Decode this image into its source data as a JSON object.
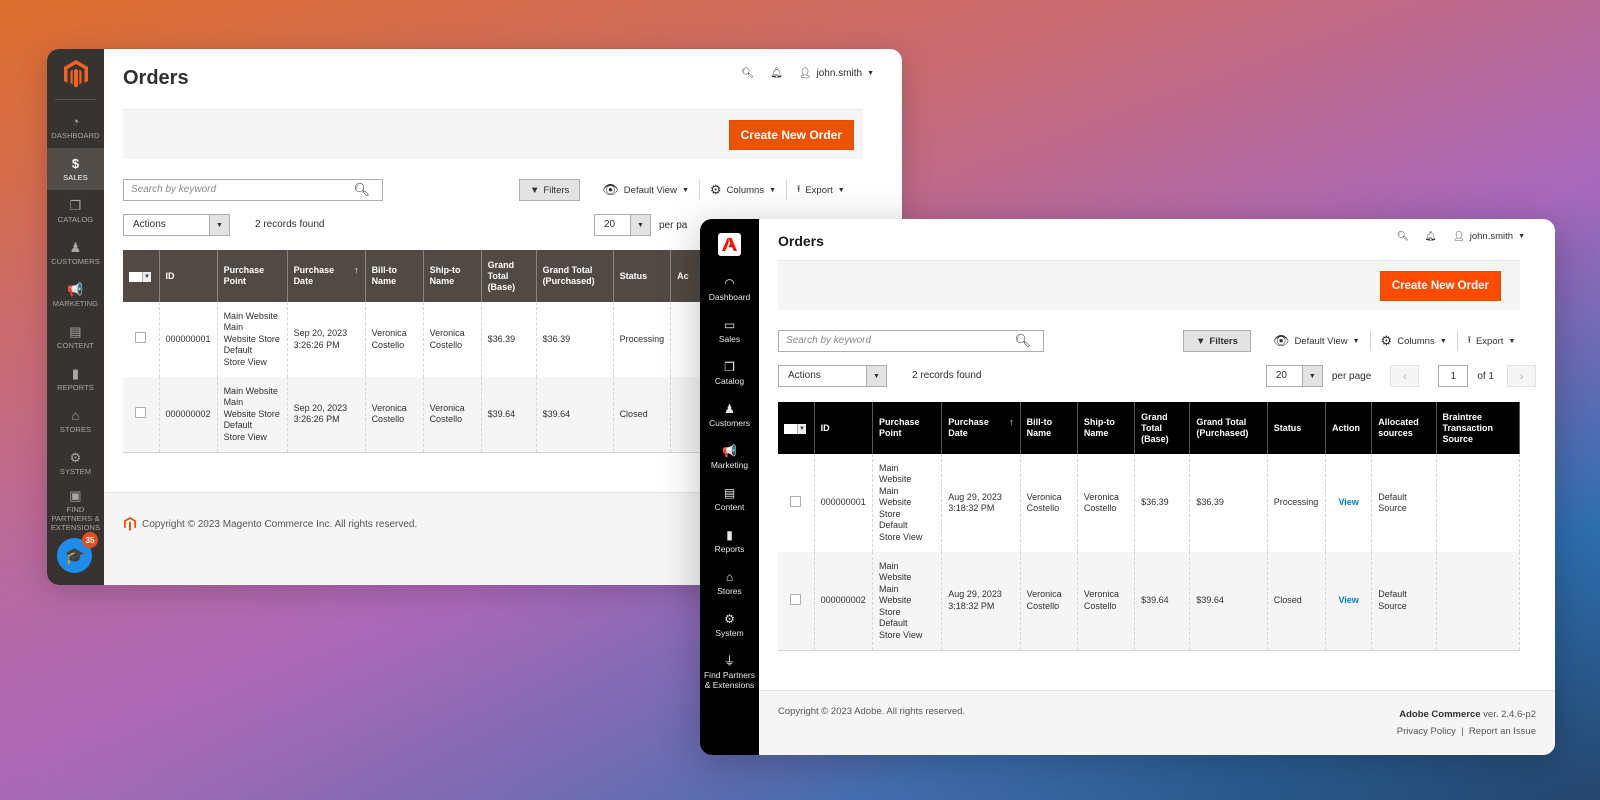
{
  "colors": {
    "magento_orange": "#eb5202",
    "adobe_orange": "#ff4b00",
    "old_sidebar": "#373330",
    "old_table_header": "#514943",
    "new_sidebar": "#000000",
    "link_blue": "#007bdb",
    "help_blue": "#1f8ceb"
  },
  "old_window": {
    "sidebar": {
      "items": [
        {
          "icon": "dashboard-icon",
          "glyph": "◔",
          "label": "DASHBOARD"
        },
        {
          "icon": "dollar-icon",
          "glyph": "$",
          "label": "SALES",
          "active": true
        },
        {
          "icon": "box-icon",
          "glyph": "❒",
          "label": "CATALOG"
        },
        {
          "icon": "person-icon",
          "glyph": "♟",
          "label": "CUSTOMERS"
        },
        {
          "icon": "megaphone-icon",
          "glyph": "📢",
          "label": "MARKETING"
        },
        {
          "icon": "content-icon",
          "glyph": "▤",
          "label": "CONTENT"
        },
        {
          "icon": "bar-chart-icon",
          "glyph": "▮",
          "label": "REPORTS"
        },
        {
          "icon": "store-icon",
          "glyph": "⌂",
          "label": "STORES"
        },
        {
          "icon": "gear-icon",
          "glyph": "⚙",
          "label": "SYSTEM"
        },
        {
          "icon": "lego-icon",
          "glyph": "▣",
          "label": "FIND PARTNERS & EXTENSIONS"
        }
      ],
      "help_badge_count": "35"
    },
    "header": {
      "title": "Orders",
      "username": "john.smith"
    },
    "create_button": "Create New Order",
    "search_placeholder": "Search by keyword",
    "toolbar": {
      "filters": "Filters",
      "view": "Default View",
      "columns": "Columns",
      "export": "Export"
    },
    "actions_label": "Actions",
    "records_found": "2 records found",
    "per_page_value": "20",
    "per_page_label": "per pa",
    "table": {
      "headers": [
        "ID",
        "Purchase Point",
        "Purchase Date",
        "Bill-to Name",
        "Ship-to Name",
        "Grand Total (Base)",
        "Grand Total (Purchased)",
        "Status",
        "Ac"
      ],
      "rows": [
        {
          "id": "000000001",
          "purchase_point": "Main Website\n Main\n Website Store\n  Default\n Store View",
          "date": "Sep 20, 2023 3:26:26 PM",
          "bill_to": "Veronica Costello",
          "ship_to": "Veronica Costello",
          "grand_base": "$36.39",
          "grand_purchased": "$36.39",
          "status": "Processing"
        },
        {
          "id": "000000002",
          "purchase_point": "Main Website\n Main\n Website Store\n  Default\n Store View",
          "date": "Sep 20, 2023 3:26:26 PM",
          "bill_to": "Veronica Costello",
          "ship_to": "Veronica Costello",
          "grand_base": "$39.64",
          "grand_purchased": "$39.64",
          "status": "Closed"
        }
      ]
    },
    "footer": {
      "copyright": "Copyright © 2023 Magento Commerce Inc. All rights reserved."
    }
  },
  "new_window": {
    "sidebar": {
      "items": [
        {
          "icon": "gauge-icon",
          "glyph": "◠",
          "label": "Dashboard"
        },
        {
          "icon": "money-icon",
          "glyph": "▭",
          "label": "Sales"
        },
        {
          "icon": "box-icon",
          "glyph": "❒",
          "label": "Catalog"
        },
        {
          "icon": "people-icon",
          "glyph": "♟",
          "label": "Customers"
        },
        {
          "icon": "megaphone-icon",
          "glyph": "📢",
          "label": "Marketing"
        },
        {
          "icon": "content-icon",
          "glyph": "▤",
          "label": "Content"
        },
        {
          "icon": "bar-chart-icon",
          "glyph": "▮",
          "label": "Reports"
        },
        {
          "icon": "store-icon",
          "glyph": "⌂",
          "label": "Stores"
        },
        {
          "icon": "gear-icon",
          "glyph": "⚙",
          "label": "System"
        },
        {
          "icon": "plug-icon",
          "glyph": "⏚",
          "label": "Find Partners & Extensions"
        }
      ]
    },
    "header": {
      "title": "Orders",
      "username": "john.smith"
    },
    "create_button": "Create New Order",
    "search_placeholder": "Search by keyword",
    "toolbar": {
      "filters": "Filters",
      "view": "Default View",
      "columns": "Columns",
      "export": "Export"
    },
    "actions_label": "Actions",
    "records_found": "2 records found",
    "pager": {
      "per_page_value": "20",
      "per_page_label": "per page",
      "current_page": "1",
      "of_label": "of 1"
    },
    "table": {
      "headers": [
        "ID",
        "Purchase Point",
        "Purchase Date",
        "Bill-to Name",
        "Ship-to Name",
        "Grand Total (Base)",
        "Grand Total (Purchased)",
        "Status",
        "Action",
        "Allocated sources",
        "Braintree Transaction Source"
      ],
      "rows": [
        {
          "id": "000000001",
          "purchase_point": "Main\nWebsite\n Main\nWebsite\nStore\n  Default\nStore View",
          "date": "Aug 29, 2023 3:18:32 PM",
          "bill_to": "Veronica Costello",
          "ship_to": "Veronica Costello",
          "grand_base": "$36.39",
          "grand_purchased": "$36.39",
          "status": "Processing",
          "action": "View",
          "allocated": "Default Source",
          "braintree": ""
        },
        {
          "id": "000000002",
          "purchase_point": "Main\nWebsite\n Main\nWebsite\nStore\n  Default\nStore View",
          "date": "Aug 29, 2023 3:18:32 PM",
          "bill_to": "Veronica Costello",
          "ship_to": "Veronica Costello",
          "grand_base": "$39.64",
          "grand_purchased": "$39.64",
          "status": "Closed",
          "action": "View",
          "allocated": "Default Source",
          "braintree": ""
        }
      ]
    },
    "footer": {
      "copyright": "Copyright © 2023 Adobe. All rights reserved.",
      "product": "Adobe Commerce",
      "version": " ver. 2.4.6-p2",
      "privacy": "Privacy Policy",
      "separator": "|",
      "report": "Report an Issue"
    }
  }
}
